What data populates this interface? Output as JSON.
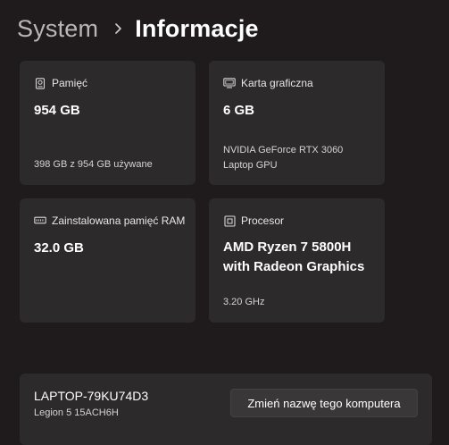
{
  "breadcrumb": {
    "parent": "System",
    "current": "Informacje"
  },
  "cards": {
    "memory": {
      "icon": "storage-icon",
      "label": "Pamięć",
      "value": "954 GB",
      "sub": "398 GB z 954 GB używane"
    },
    "gpu": {
      "icon": "display-icon",
      "label": "Karta graficzna",
      "value": "6 GB",
      "sub_line1": "NVIDIA GeForce RTX 3060",
      "sub_line2": "Laptop GPU"
    },
    "ram": {
      "icon": "ram-icon",
      "label": "Zainstalowana pamięć RAM",
      "value": "32.0 GB"
    },
    "cpu": {
      "icon": "processor-icon",
      "label": "Procesor",
      "value_line1": "AMD Ryzen 7 5800H",
      "value_line2": "with Radeon Graphics",
      "sub": "3.20 GHz"
    }
  },
  "device": {
    "name": "LAPTOP-79KU74D3",
    "model": "Legion 5 15ACH6H",
    "rename_label": "Zmień nazwę tego komputera"
  }
}
